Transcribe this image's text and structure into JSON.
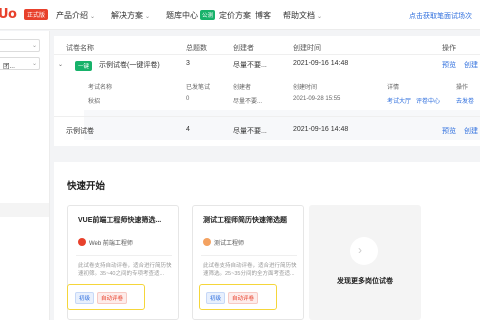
{
  "nav": {
    "logo": "Uo",
    "logo_badge": "正式版",
    "items": [
      {
        "label": "产品介绍",
        "chevron": "⌄"
      },
      {
        "label": "解决方案",
        "chevron": "⌄"
      },
      {
        "label": "题库中心",
        "badge": "公测"
      },
      {
        "label": "定价方案"
      },
      {
        "label": "博客"
      },
      {
        "label": "帮助文档",
        "chevron": "⌄"
      }
    ],
    "cta": "点击获取笔面试场次"
  },
  "sidebar": {
    "fields": [
      "",
      "团..."
    ]
  },
  "table": {
    "headers": [
      "试卷名称",
      "总题数",
      "创建者",
      "创建时间",
      "操作"
    ],
    "rows": [
      {
        "badge": "一键",
        "name": "示例试卷(一键评卷)",
        "count": "3",
        "creator": "尽量不要...",
        "time": "2021-09-16 14:48",
        "action1": "预览",
        "action2": "创建"
      },
      {
        "name": "示例试卷",
        "count": "4",
        "creator": "尽量不要...",
        "time": "2021-09-16 14:48",
        "action1": "预览",
        "action2": "创建"
      }
    ],
    "sub_headers": [
      "考试名称",
      "已发笔试",
      "创建者",
      "创建时间",
      "详情",
      "操作"
    ],
    "sub_row": {
      "name": "秋招",
      "sent": "0",
      "creator": "尽量不要...",
      "time": "2021-09-28 15:55",
      "detail1": "考试大厅",
      "detail2": "评卷中心",
      "action": "去发卷"
    }
  },
  "quick_start": {
    "title": "快速开始",
    "papers": [
      {
        "title": "VUE前端工程师快速筛选...",
        "role": "Web 前端工程师",
        "desc": "此试卷支持自动评卷，适合进行简历快速初筛。35~40之间的专项考查适...",
        "tags": [
          "初级",
          "自动评卷"
        ]
      },
      {
        "title": "测试工程师简历快速筛选题",
        "role": "测试工程师",
        "desc": "此试卷支持自动评卷，适合进行简历快速筛选。25~35分间的全方面考查适...",
        "tags": [
          "初级",
          "自动评卷"
        ]
      }
    ],
    "more_label": "发现更多岗位试卷"
  }
}
